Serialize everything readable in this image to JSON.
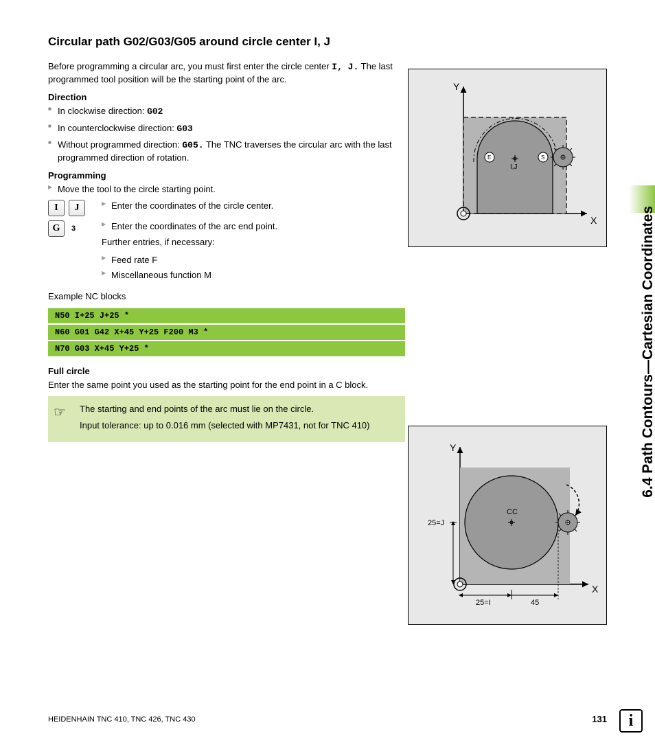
{
  "sidebar": "6.4 Path Contours—Cartesian Coordinates",
  "title": "Circular path G02/G03/G05 around circle center I, J",
  "intro": {
    "pre": "Before programming a circular arc, you must first enter the circle center ",
    "codes": "I, J.",
    "post": " The last programmed tool position will be the starting point of the arc."
  },
  "direction": {
    "heading": "Direction",
    "items": [
      {
        "text": "In clockwise direction: ",
        "code": "G02"
      },
      {
        "text": "In counterclockwise direction: ",
        "code": "G03"
      },
      {
        "text": "Without programmed direction: ",
        "code": "G05.",
        "after": " The TNC traverses the circular arc with the last programmed direction of rotation."
      }
    ]
  },
  "programming": {
    "heading": "Programming",
    "step1": "Move the tool to the circle starting point.",
    "row1_keys": [
      "I",
      "J"
    ],
    "row1_text": "Enter the coordinates of the circle center.",
    "row2_key": "G",
    "row2_badge": "3",
    "row2_text": "Enter the coordinates of the arc end point.",
    "further": "Further entries, if necessary:",
    "feed": "Feed rate F",
    "misc": "Miscellaneous function M"
  },
  "example_label": "Example NC blocks",
  "nc_blocks": [
    "N50 I+25 J+25 *",
    "N60 G01 G42 X+45 Y+25 F200 M3 *",
    "N70 G03 X+45 Y+25 *"
  ],
  "fullcircle": {
    "heading": "Full circle",
    "text": "Enter the same point you used as the starting point for the end point in a C block."
  },
  "note": {
    "line1": "The starting and end points of the arc must lie on the circle.",
    "line2": "Input tolerance: up to 0.016 mm (selected with MP7431, not for TNC 410)"
  },
  "fig1": {
    "y": "Y",
    "x": "X",
    "ij": "I,J",
    "e": "E",
    "s": "S"
  },
  "fig2": {
    "y": "Y",
    "x": "X",
    "cc": "CC",
    "j": "25=J",
    "i": "25=I",
    "x45": "45"
  },
  "footer": {
    "left": "HEIDENHAIN TNC 410, TNC 426, TNC 430",
    "page": "131"
  },
  "info_icon": "i"
}
